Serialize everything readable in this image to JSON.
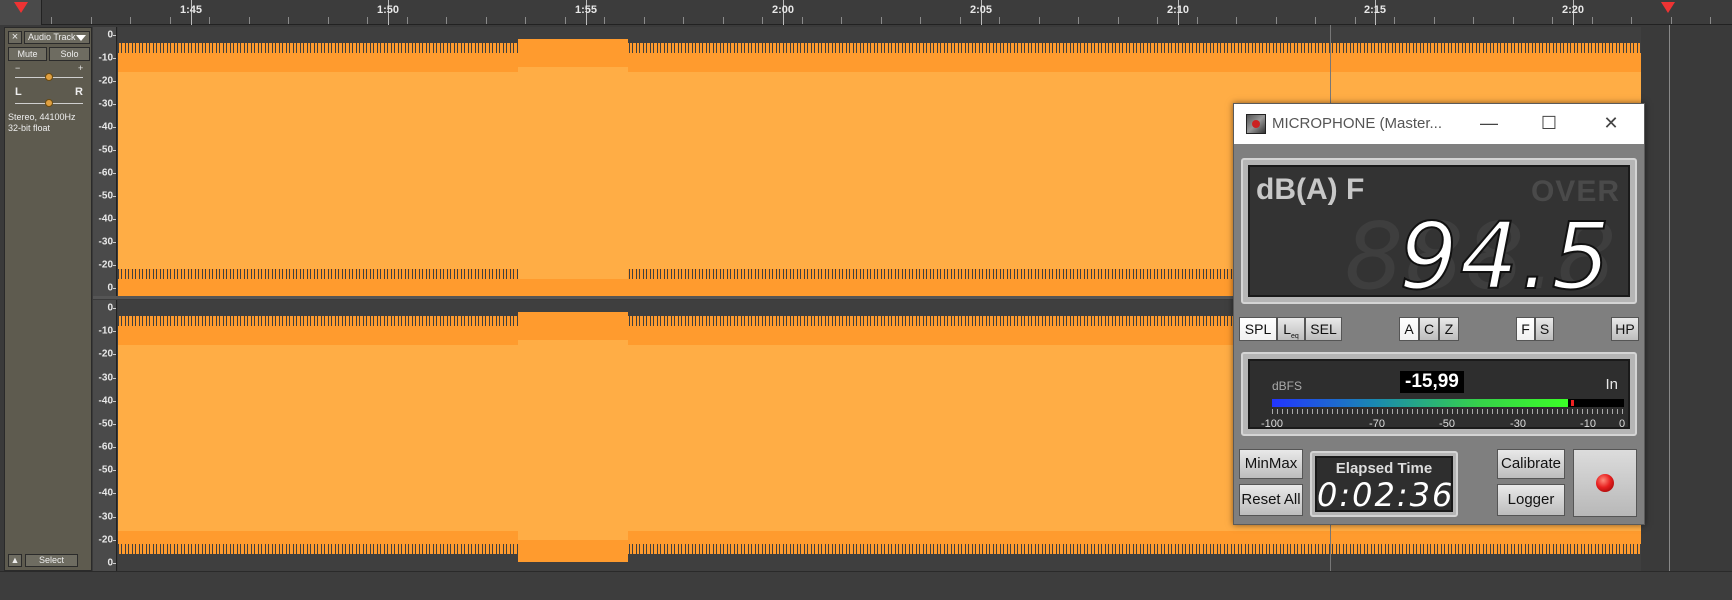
{
  "timeline": {
    "labels": [
      "1:45",
      "1:50",
      "1:55",
      "2:00",
      "2:05",
      "2:10",
      "2:15",
      "2:20"
    ]
  },
  "track": {
    "close_symbol": "×",
    "name": "Audio Track",
    "mute_label": "Mute",
    "solo_label": "Solo",
    "gain_minus": "−",
    "gain_plus": "+",
    "pan_left": "L",
    "pan_right": "R",
    "info_line1": "Stereo, 44100Hz",
    "info_line2": "32-bit float",
    "select_label": "Select",
    "collapse_symbol": "▲"
  },
  "db_scale": [
    "0",
    "-10",
    "-20",
    "-30",
    "-40",
    "-50",
    "-60",
    "-50",
    "-40",
    "-30",
    "-20",
    "0"
  ],
  "meter": {
    "title": "MICROPHONE (Master...",
    "minimize": "—",
    "maximize": "☐",
    "close": "✕",
    "unit": "dB(A) F",
    "over": "OVER",
    "ghost": "888.8",
    "value": "94.5",
    "mode_buttons": [
      "SPL",
      "L",
      "SEL"
    ],
    "leq_sub": "eq",
    "weight_buttons": [
      "A",
      "C",
      "Z"
    ],
    "time_buttons": [
      "F",
      "S"
    ],
    "hp_label": "HP",
    "dbfs_label": "dBFS",
    "dbfs_value": "-15,99",
    "in_label": "In",
    "dbfs_fill_fraction": 0.84,
    "dbfs_peak_fraction": 0.85,
    "dbfs_scale": [
      "-100",
      "-70",
      "-50",
      "-30",
      "-10",
      "0"
    ],
    "minmax_label": "MinMax",
    "reset_label": "Reset All",
    "elapsed_title": "Elapsed Time",
    "elapsed_value": "0:02:36",
    "calibrate_label": "Calibrate",
    "logger_label": "Logger"
  },
  "colors": {
    "wave_outer": "#ff9b2e",
    "wave_inner": "#ffad45",
    "rec_led": "#e82020"
  }
}
